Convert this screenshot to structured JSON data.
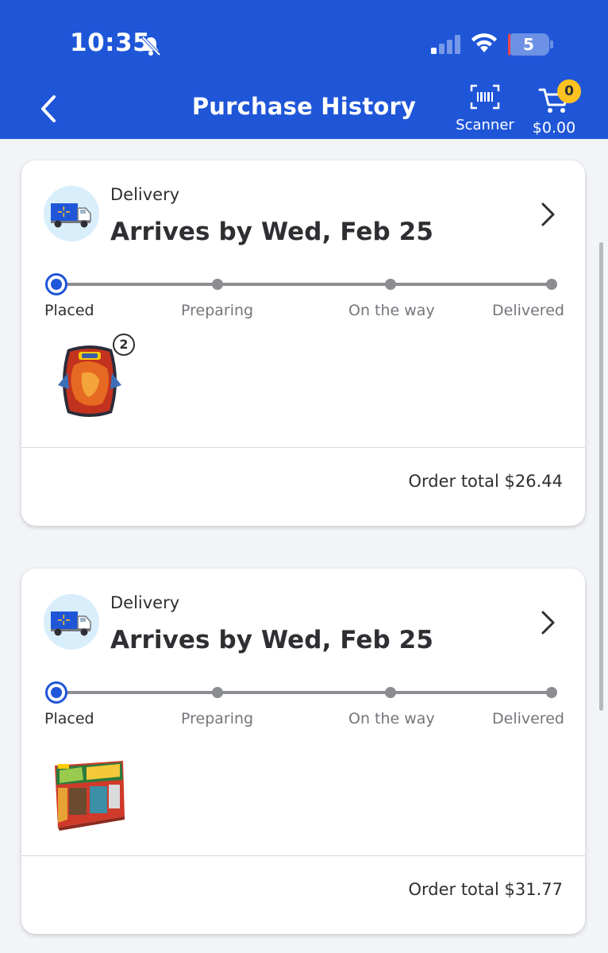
{
  "status_bar": {
    "time": "10:35",
    "battery_level": "5",
    "icons": [
      "bell-slash-icon",
      "cellular-signal-icon",
      "wifi-icon",
      "battery-icon"
    ]
  },
  "header": {
    "title": "Purchase History",
    "scanner_label": "Scanner",
    "cart_count": "0",
    "cart_total": "$0.00",
    "background_color": "#1f56d8",
    "badge_color": "#ffc220"
  },
  "orders": [
    {
      "method": "Delivery",
      "arrival": "Arrives by Wed, Feb 25",
      "steps": [
        "Placed",
        "Preparing",
        "On the way",
        "Delivered"
      ],
      "current_step": "Placed",
      "item_quantity": "2",
      "item_icon": "pokemon-tin-image",
      "total": "Order total $26.44"
    },
    {
      "method": "Delivery",
      "arrival": "Arrives by Wed, Feb 25",
      "steps": [
        "Placed",
        "Preparing",
        "On the way",
        "Delivered"
      ],
      "current_step": "Placed",
      "item_icon": "pokemon-collection-box-image",
      "total": "Order total $31.77"
    }
  ]
}
